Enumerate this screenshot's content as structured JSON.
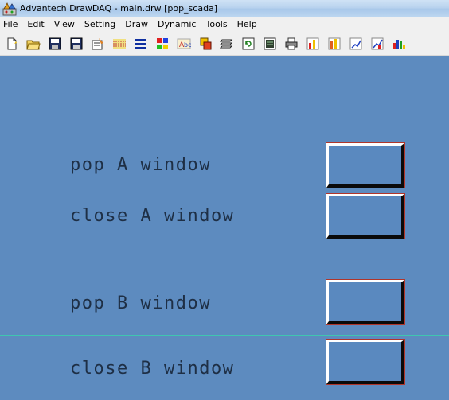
{
  "window": {
    "title": "Advantech DrawDAQ - main.drw [pop_scada]",
    "icon": "drawdaq-app-icon"
  },
  "menu": [
    "File",
    "Edit",
    "View",
    "Setting",
    "Draw",
    "Dynamic",
    "Tools",
    "Help"
  ],
  "toolbar": {
    "icons": [
      "new-file-icon",
      "open-folder-icon",
      "save-icon",
      "save-as-icon",
      "property-icon",
      "grid-icon",
      "align-icon",
      "color-palette-icon",
      "text-icon",
      "layer-icon",
      "stack-icon",
      "refresh-icon",
      "document-icon",
      "print-icon",
      "chart-red-icon",
      "chart-orange-icon",
      "chart-blue-icon",
      "chart-mixed-icon",
      "bar-chart-icon"
    ]
  },
  "canvas": {
    "background": "#5d8bbf",
    "rows": [
      {
        "label": "pop A window"
      },
      {
        "label": "close A window"
      },
      {
        "label": "pop B window"
      },
      {
        "label": "close B window"
      }
    ]
  }
}
